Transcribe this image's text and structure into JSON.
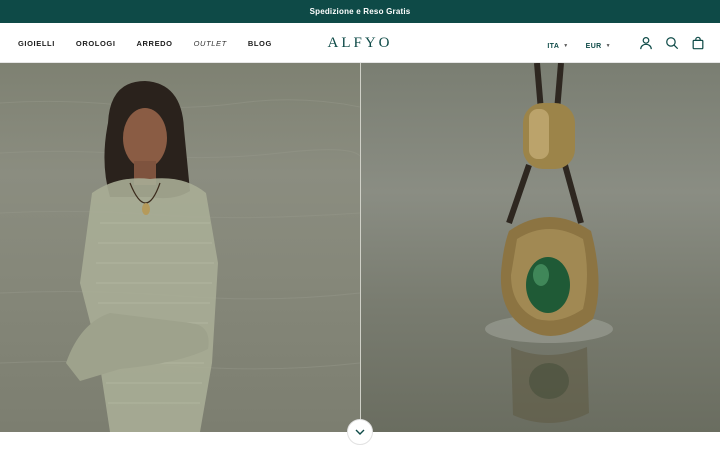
{
  "announcement": {
    "text": "Spedizione e Reso Gratis"
  },
  "nav": {
    "items": [
      {
        "label": "GIOIELLI"
      },
      {
        "label": "OROLOGI"
      },
      {
        "label": "ARREDO"
      },
      {
        "label": "OUTLET"
      },
      {
        "label": "BLOG"
      }
    ]
  },
  "logo": {
    "text": "ALFYO"
  },
  "header_right": {
    "language": "ITA",
    "currency": "EUR",
    "icons": [
      "account-icon",
      "search-icon",
      "bag-icon"
    ]
  },
  "hero": {
    "left_image": "woman-in-knit-dress-in-water",
    "right_image": "gold-pendant-with-green-stone-on-cord"
  },
  "colors": {
    "brand": "#0e4a47",
    "announcement_bg": "#0e4a47",
    "background": "#ffffff"
  }
}
